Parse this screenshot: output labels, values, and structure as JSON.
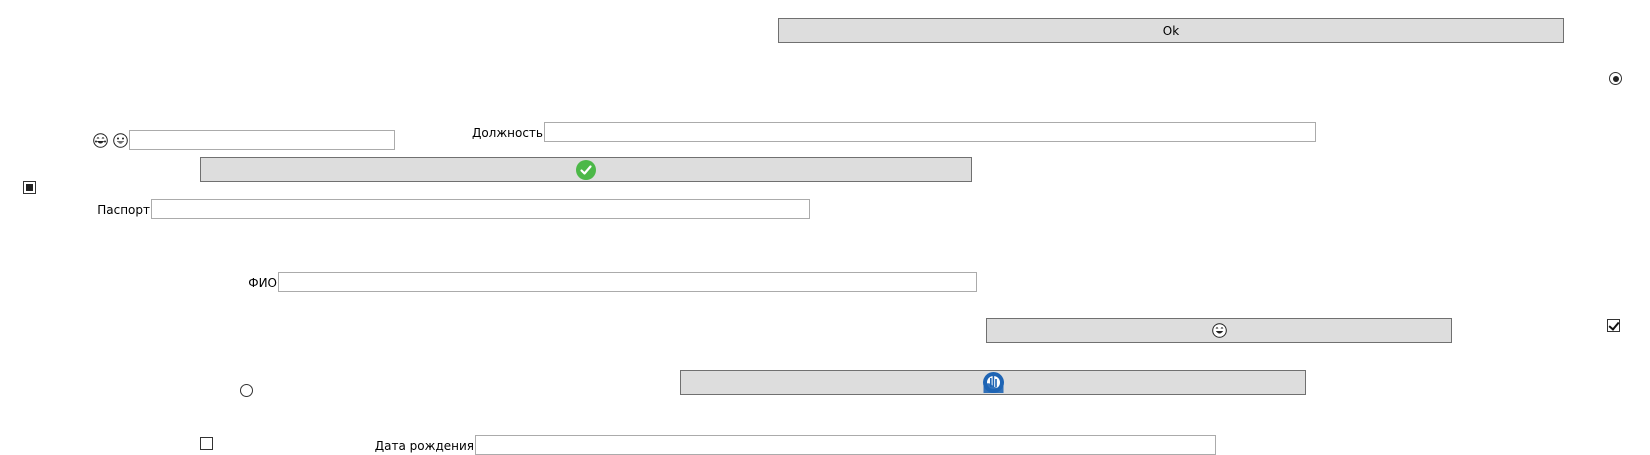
{
  "buttons": {
    "ok_label": "Ok",
    "check_icon": "green-checkmark-icon",
    "laugh_icon": "laughing-face-icon",
    "blue_icon": "blue-circular-logo-icon"
  },
  "fields": {
    "position_label": "Должность",
    "position_value": "",
    "passport_label": "Паспорт",
    "passport_value": "",
    "fio_label": "ФИО",
    "fio_value": "",
    "birthdate_label": "Дата рождения",
    "birthdate_value": "",
    "emoji_field_value": ""
  },
  "emoji_label": {
    "icons": [
      "laughing-face-icon",
      "grinning-face-icon"
    ]
  },
  "controls": {
    "radio_top_right_checked": true,
    "radio_left_checked": false,
    "checkbox_left_state": "indeterminate",
    "checkbox_right_checked": true,
    "checkbox_bottom_checked": false
  },
  "colors": {
    "button_bg": "#dddddd",
    "button_border": "#707070",
    "field_border": "#ababab",
    "check_green": "#4cb848",
    "blue_logo": "#1e64b4"
  }
}
